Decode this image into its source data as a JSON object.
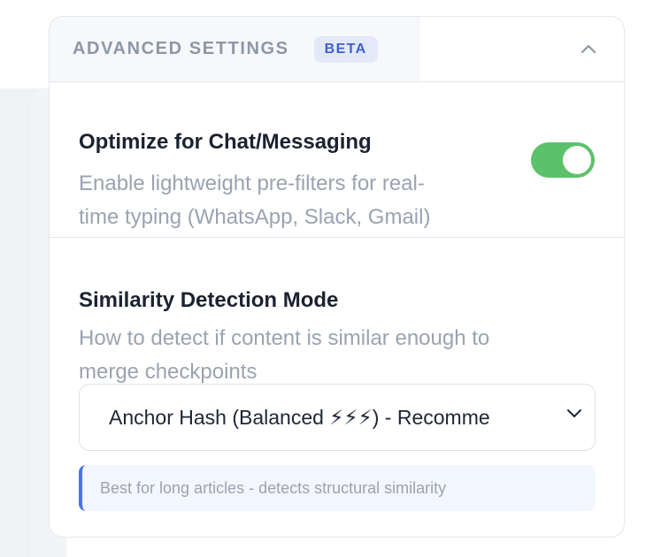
{
  "header": {
    "title": "ADVANCED SETTINGS",
    "badge": "BETA"
  },
  "chat_option": {
    "title": "Optimize for Chat/Messaging",
    "description_line1": "Enable lightweight pre-filters for real-",
    "description_line2": "time typing (WhatsApp, Slack, Gmail)",
    "enabled": true
  },
  "similarity": {
    "title": "Similarity Detection Mode",
    "description_line1": "How to detect if content is similar enough to",
    "description_line2": "merge checkpoints",
    "selected": "Anchor Hash (Balanced ⚡⚡⚡) - Recomme",
    "hint": "Best for long articles - detects structural similarity"
  },
  "colors": {
    "accent": "#4a74e8",
    "toggle_on": "#5cc16a",
    "badge_bg": "#e3e9f8",
    "badge_text": "#3e5fd3"
  },
  "icons": {
    "collapse": "chevron-up-icon",
    "select": "chevron-down-icon"
  }
}
